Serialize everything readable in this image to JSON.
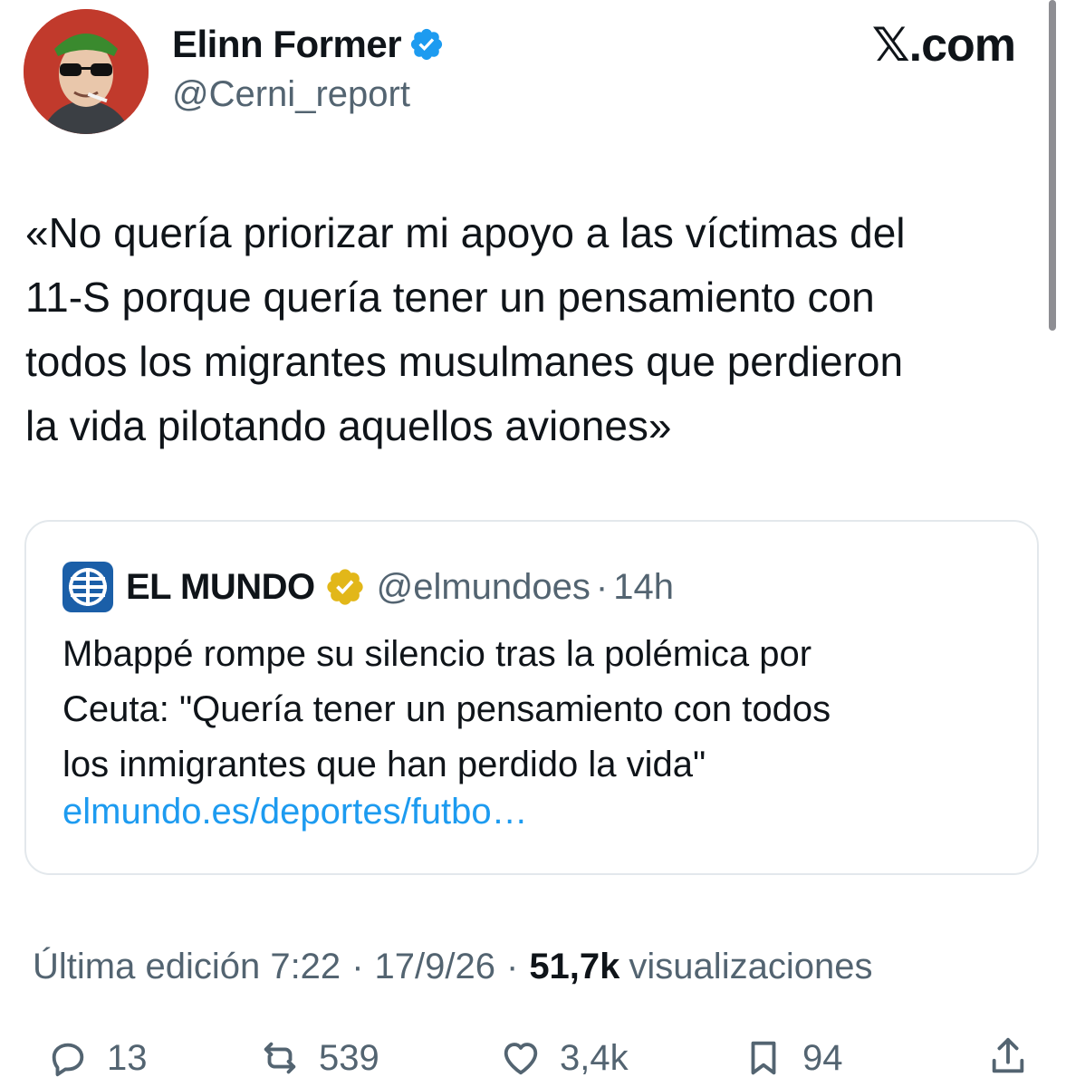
{
  "author": {
    "name": "Elinn Former",
    "handle": "@Cerni_report",
    "avatar_icon": "avatar-photo"
  },
  "brand": "𝕏.com",
  "tweet": {
    "text_lines": [
      "«No quería priorizar mi apoyo a las víctimas del",
      "11-S porque quería tener un pensamiento con",
      "todos los migrantes musulmanes que perdieron",
      "la vida pilotando aquellos aviones»"
    ]
  },
  "quoted": {
    "name": "EL MUNDO",
    "handle": "@elmundoes",
    "separator": "·",
    "time": "14h",
    "text_lines": [
      "Mbappé rompe su silencio tras la polémica por",
      "Ceuta: \"Quería tener un pensamiento con todos",
      "los inmigrantes que han perdido la vida\""
    ],
    "link": "elmundo.es/deportes/futbo…"
  },
  "meta": {
    "edited": "Última edición 7:22",
    "separator": "·",
    "date": "17/9/26",
    "views_count": "51,7k",
    "views_label": "visualizaciones"
  },
  "actions": {
    "replies": "13",
    "reposts": "539",
    "likes": "3,4k",
    "bookmarks": "94"
  },
  "colors": {
    "verified_blue": "#1d9bf0",
    "verified_gold": "#e2b719",
    "secondary_text": "#536471",
    "link": "#1d9bf0"
  }
}
